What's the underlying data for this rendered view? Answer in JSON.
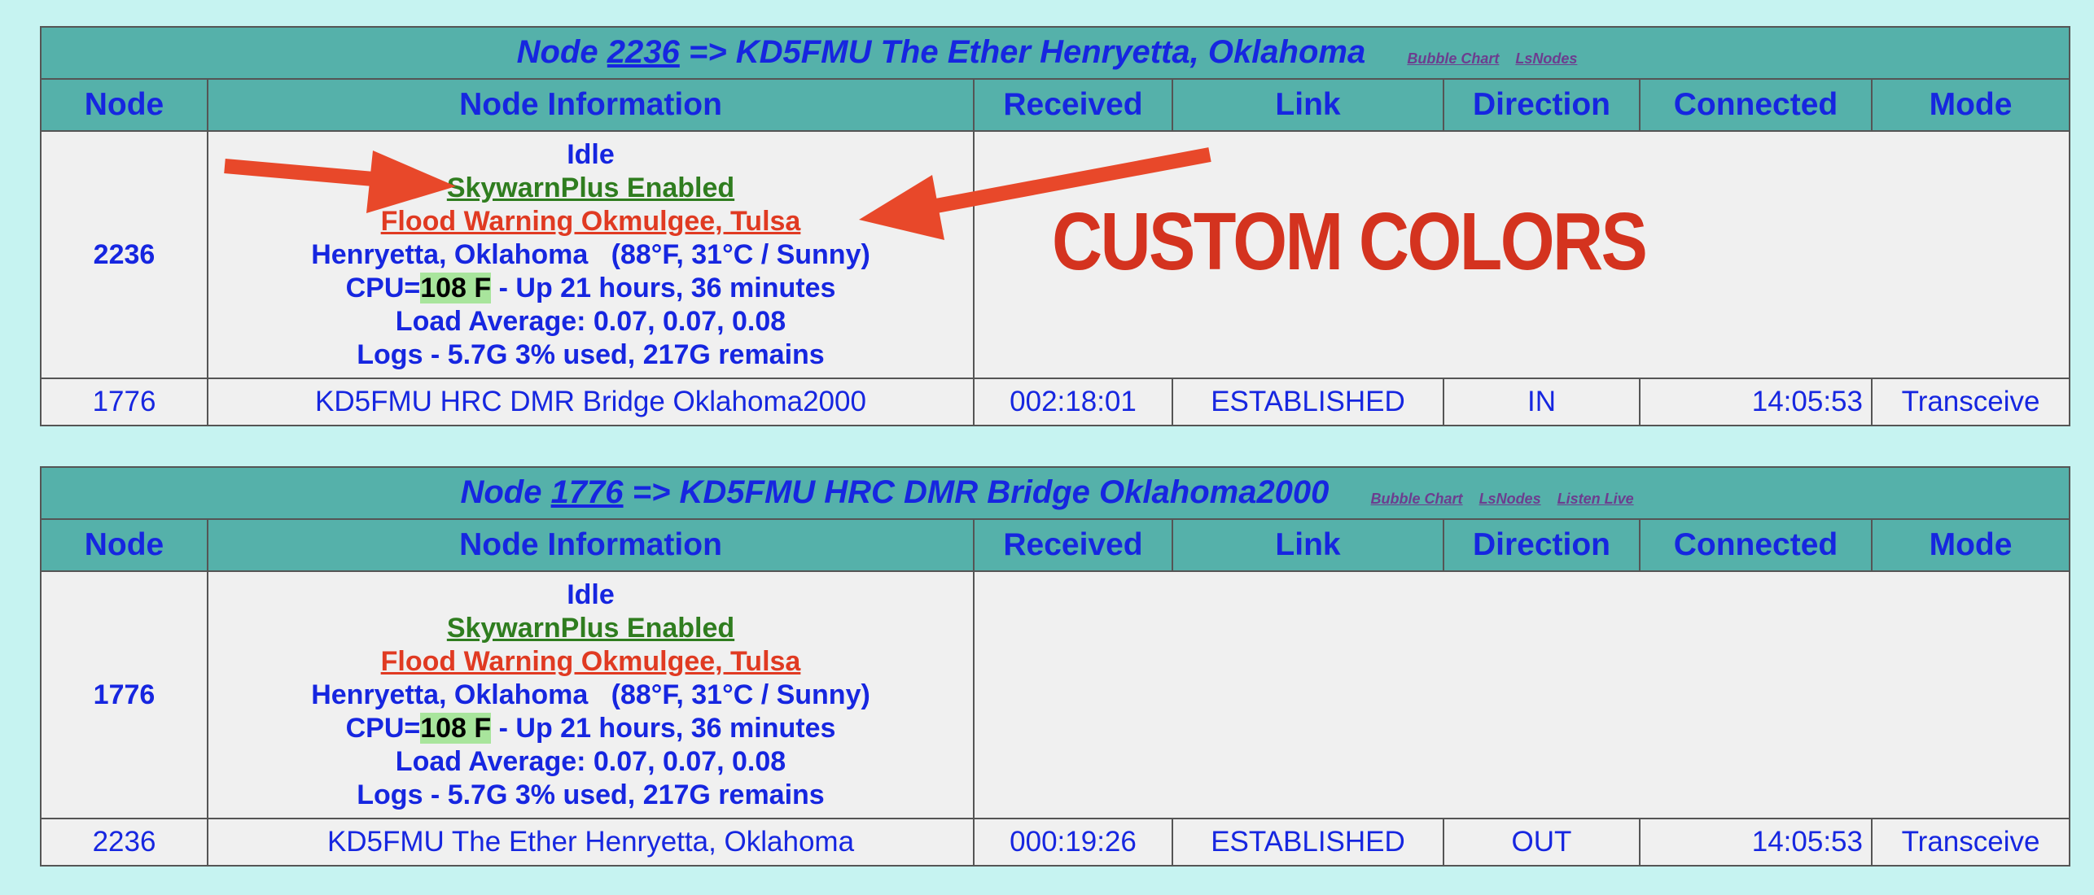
{
  "tables": [
    {
      "title_prefix": "Node ",
      "title_node": "2236",
      "title_suffix": " => KD5FMU The Ether Henryetta, Oklahoma",
      "links": [
        "Bubble Chart",
        "LsNodes"
      ],
      "headers": [
        "Node",
        "Node Information",
        "Received",
        "Link",
        "Direction",
        "Connected",
        "Mode"
      ],
      "node": "2236",
      "info": {
        "status": "Idle",
        "skywarn": "SkywarnPlus Enabled",
        "flood": "Flood Warning Okmulgee, Tulsa",
        "weather": "Henryetta, Oklahoma   (88°F, 31°C / Sunny)",
        "cpu_prefix": "CPU=",
        "cpu_temp": "108 F",
        "cpu_suffix": " - Up 21 hours, 36 minutes",
        "load": "Load Average: 0.07, 0.07, 0.08",
        "logs": "Logs - 5.7G 3% used, 217G remains"
      },
      "link_row": {
        "node": "1776",
        "info": "KD5FMU HRC DMR Bridge Oklahoma2000",
        "received": "002:18:01",
        "link": "ESTABLISHED",
        "direction": "IN",
        "connected": "14:05:53",
        "mode": "Transceive"
      }
    },
    {
      "title_prefix": "Node ",
      "title_node": "1776",
      "title_suffix": " => KD5FMU HRC DMR Bridge Oklahoma2000",
      "links": [
        "Bubble Chart",
        "LsNodes",
        "Listen Live"
      ],
      "headers": [
        "Node",
        "Node Information",
        "Received",
        "Link",
        "Direction",
        "Connected",
        "Mode"
      ],
      "node": "1776",
      "info": {
        "status": "Idle",
        "skywarn": "SkywarnPlus Enabled",
        "flood": "Flood Warning Okmulgee, Tulsa",
        "weather": "Henryetta, Oklahoma   (88°F, 31°C / Sunny)",
        "cpu_prefix": "CPU=",
        "cpu_temp": "108 F",
        "cpu_suffix": " - Up 21 hours, 36 minutes",
        "load": "Load Average: 0.07, 0.07, 0.08",
        "logs": "Logs - 5.7G 3% used, 217G remains"
      },
      "link_row": {
        "node": "2236",
        "info": "KD5FMU The Ether Henryetta, Oklahoma",
        "received": "000:19:26",
        "link": "ESTABLISHED",
        "direction": "OUT",
        "connected": "14:05:53",
        "mode": "Transceive"
      }
    }
  ],
  "annotation": {
    "text": "CUSTOM COLORS",
    "color": "#d4331f"
  },
  "colors": {
    "page_bg": "#c6f3f1",
    "header_bg": "#55b1aa",
    "text_blue": "#1626e0",
    "skywarn_green": "#2f7d1f",
    "flood_red": "#e03a22",
    "temp_highlight": "#a8e59c",
    "link_purple": "#6d3d8f"
  }
}
